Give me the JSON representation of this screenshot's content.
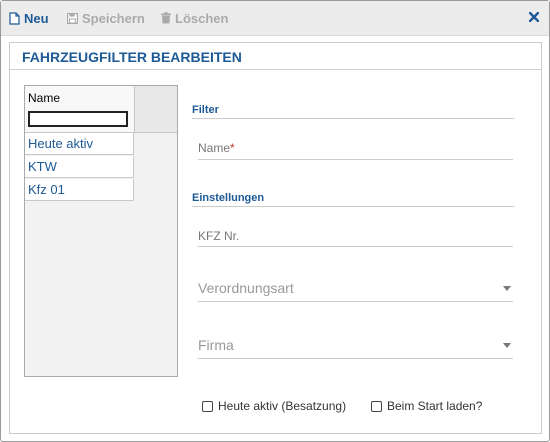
{
  "toolbar": {
    "new_label": "Neu",
    "save_label": "Speichern",
    "delete_label": "Löschen"
  },
  "panel": {
    "title": "FAHRZEUGFILTER BEARBEITEN"
  },
  "grid": {
    "column_header": "Name",
    "rows": [
      "Heute aktiv",
      "KTW",
      "Kfz 01"
    ]
  },
  "form": {
    "filter_section": "Filter",
    "name_label": "Name",
    "name_required_mark": "*",
    "settings_section": "Einstellungen",
    "kfz_label": "KFZ Nr.",
    "verordnungsart_label": "Verordnungsart",
    "firma_label": "Firma",
    "checkbox_active_label": "Heute aktiv (Besatzung)",
    "checkbox_start_label": "Beim Start laden?"
  },
  "colors": {
    "accent": "#1d5a96",
    "required": "#c0392b"
  },
  "icons": [
    "new-document-icon",
    "save-icon",
    "trash-icon",
    "close-icon"
  ]
}
